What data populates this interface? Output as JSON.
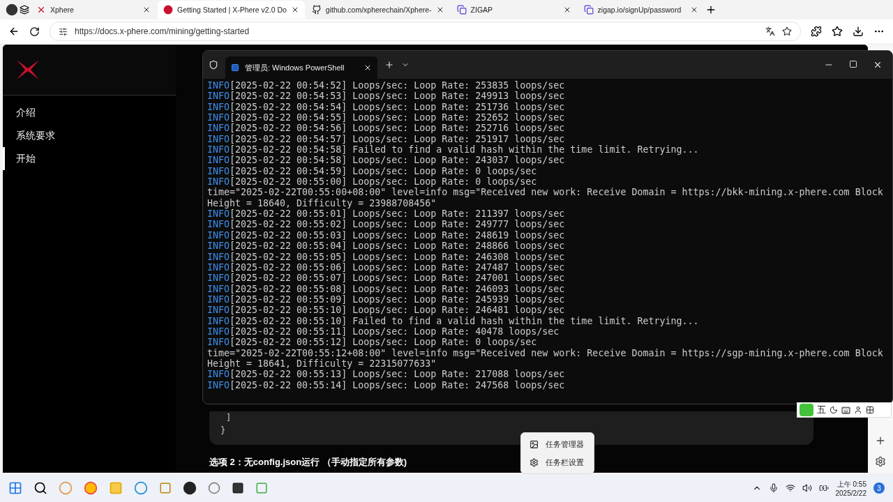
{
  "browser_tabs": [
    {
      "title": "Xphere",
      "selected": false
    },
    {
      "title": "Getting Started | X-Phere v2.0 Do",
      "selected": true
    },
    {
      "title": "github.com/xpherechain/Xphere-",
      "selected": false
    },
    {
      "title": "ZIGAP",
      "selected": false
    },
    {
      "title": "zigap.io/signUp/password",
      "selected": false
    }
  ],
  "address": {
    "url": "https://docs.x-phere.com/mining/getting-started"
  },
  "docs_sidebar": {
    "items": [
      {
        "label": "介绍",
        "selected": false
      },
      {
        "label": "系统要求",
        "selected": false
      },
      {
        "label": "开始",
        "selected": true
      }
    ]
  },
  "content": {
    "code_lines": [
      "]",
      "}"
    ],
    "heading": "选项 2：无config.json运行 （手动指定所有参数)"
  },
  "terminal": {
    "tab_title": "管理员: Windows PowerShell",
    "lines": [
      {
        "kind": "info",
        "level": "INFO",
        "text": "[2025-02-22 00:54:52] Loops/sec: Loop Rate: 253835 loops/sec"
      },
      {
        "kind": "info",
        "level": "INFO",
        "text": "[2025-02-22 00:54:53] Loops/sec: Loop Rate: 249913 loops/sec"
      },
      {
        "kind": "info",
        "level": "INFO",
        "text": "[2025-02-22 00:54:54] Loops/sec: Loop Rate: 251736 loops/sec"
      },
      {
        "kind": "info",
        "level": "INFO",
        "text": "[2025-02-22 00:54:55] Loops/sec: Loop Rate: 252652 loops/sec"
      },
      {
        "kind": "info",
        "level": "INFO",
        "text": "[2025-02-22 00:54:56] Loops/sec: Loop Rate: 252716 loops/sec"
      },
      {
        "kind": "info",
        "level": "INFO",
        "text": "[2025-02-22 00:54:57] Loops/sec: Loop Rate: 251917 loops/sec"
      },
      {
        "kind": "info",
        "level": "INFO",
        "text": "[2025-02-22 00:54:58] Failed to find a valid hash within the time limit. Retrying..."
      },
      {
        "kind": "info",
        "level": "INFO",
        "text": "[2025-02-22 00:54:58] Loops/sec: Loop Rate: 243037 loops/sec"
      },
      {
        "kind": "info",
        "level": "INFO",
        "text": "[2025-02-22 00:54:59] Loops/sec: Loop Rate: 0 loops/sec"
      },
      {
        "kind": "info",
        "level": "INFO",
        "text": "[2025-02-22 00:55:00] Loops/sec: Loop Rate: 0 loops/sec"
      },
      {
        "kind": "raw",
        "text": "time=\"2025-02-22T00:55:00+08:00\" level=info msg=\"Received new work: Receive Domain = https://bkk-mining.x-phere.com Block Height = 18640, Difficulty = 23988708456\""
      },
      {
        "kind": "info",
        "level": "INFO",
        "text": "[2025-02-22 00:55:01] Loops/sec: Loop Rate: 211397 loops/sec"
      },
      {
        "kind": "info",
        "level": "INFO",
        "text": "[2025-02-22 00:55:02] Loops/sec: Loop Rate: 249777 loops/sec"
      },
      {
        "kind": "info",
        "level": "INFO",
        "text": "[2025-02-22 00:55:03] Loops/sec: Loop Rate: 248619 loops/sec"
      },
      {
        "kind": "info",
        "level": "INFO",
        "text": "[2025-02-22 00:55:04] Loops/sec: Loop Rate: 248866 loops/sec"
      },
      {
        "kind": "info",
        "level": "INFO",
        "text": "[2025-02-22 00:55:05] Loops/sec: Loop Rate: 246308 loops/sec"
      },
      {
        "kind": "info",
        "level": "INFO",
        "text": "[2025-02-22 00:55:06] Loops/sec: Loop Rate: 247487 loops/sec"
      },
      {
        "kind": "info",
        "level": "INFO",
        "text": "[2025-02-22 00:55:07] Loops/sec: Loop Rate: 247001 loops/sec"
      },
      {
        "kind": "info",
        "level": "INFO",
        "text": "[2025-02-22 00:55:08] Loops/sec: Loop Rate: 246093 loops/sec"
      },
      {
        "kind": "info",
        "level": "INFO",
        "text": "[2025-02-22 00:55:09] Loops/sec: Loop Rate: 245939 loops/sec"
      },
      {
        "kind": "info",
        "level": "INFO",
        "text": "[2025-02-22 00:55:10] Loops/sec: Loop Rate: 246481 loops/sec"
      },
      {
        "kind": "info",
        "level": "INFO",
        "text": "[2025-02-22 00:55:10] Failed to find a valid hash within the time limit. Retrying..."
      },
      {
        "kind": "info",
        "level": "INFO",
        "text": "[2025-02-22 00:55:11] Loops/sec: Loop Rate: 40478 loops/sec"
      },
      {
        "kind": "info",
        "level": "INFO",
        "text": "[2025-02-22 00:55:12] Loops/sec: Loop Rate: 0 loops/sec"
      },
      {
        "kind": "raw",
        "text": "time=\"2025-02-22T00:55:12+08:00\" level=info msg=\"Received new work: Receive Domain = https://sgp-mining.x-phere.com Block Height = 18641, Difficulty = 22315077633\""
      },
      {
        "kind": "info",
        "level": "INFO",
        "text": "[2025-02-22 00:55:13] Loops/sec: Loop Rate: 217088 loops/sec"
      },
      {
        "kind": "info",
        "level": "INFO",
        "text": "[2025-02-22 00:55:14] Loops/sec: Loop Rate: 247568 loops/sec"
      }
    ]
  },
  "ime_toolbar": {
    "mode": "五"
  },
  "context_menu": {
    "items": [
      "任务管理器",
      "任务栏设置"
    ]
  },
  "taskbar": {
    "time": "上午 0:55",
    "date": "2025/2/22",
    "notification_count": "3"
  }
}
